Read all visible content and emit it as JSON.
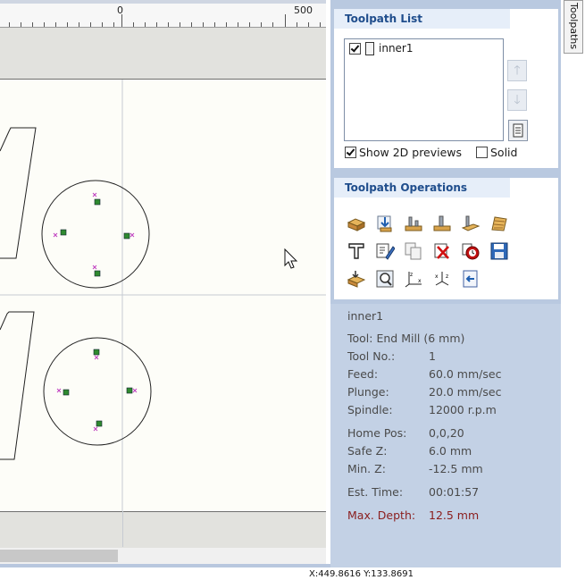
{
  "ruler": {
    "label_zero": "0",
    "label_500": "500"
  },
  "status": {
    "coordinates": "X:449.8616 Y:133.8691"
  },
  "side_tab": {
    "label": "Toolpaths"
  },
  "toolpath_list": {
    "title": "Toolpath List",
    "items": [
      {
        "name": "inner1",
        "checked": true
      }
    ],
    "show_2d_previews": "Show 2D previews",
    "solid": "Solid"
  },
  "toolpath_operations": {
    "title": "Toolpath Operations"
  },
  "toolpath_info": {
    "name": "inner1",
    "tool": "Tool: End Mill (6 mm)",
    "rows": [
      {
        "label": "Tool No.:",
        "value": "1"
      },
      {
        "label": "Feed:",
        "value": "60.0 mm/sec"
      },
      {
        "label": "Plunge:",
        "value": "20.0 mm/sec"
      },
      {
        "label": "Spindle:",
        "value": "12000 r.p.m"
      },
      {
        "label": "Home Pos:",
        "value": "0,0,20"
      },
      {
        "label": "Safe Z:",
        "value": "6.0 mm"
      },
      {
        "label": "Min. Z:",
        "value": "-12.5 mm"
      },
      {
        "label": "Est. Time:",
        "value": "00:01:57"
      },
      {
        "label": "Max. Depth:",
        "value": "12.5 mm"
      }
    ]
  },
  "colors": {
    "panel_bg": "#b9c9e0",
    "section_title": "#1f4d8c",
    "max_depth": "#8a1d1d",
    "node_fill": "#2f8a2f",
    "node_handle": "#c040c0"
  }
}
